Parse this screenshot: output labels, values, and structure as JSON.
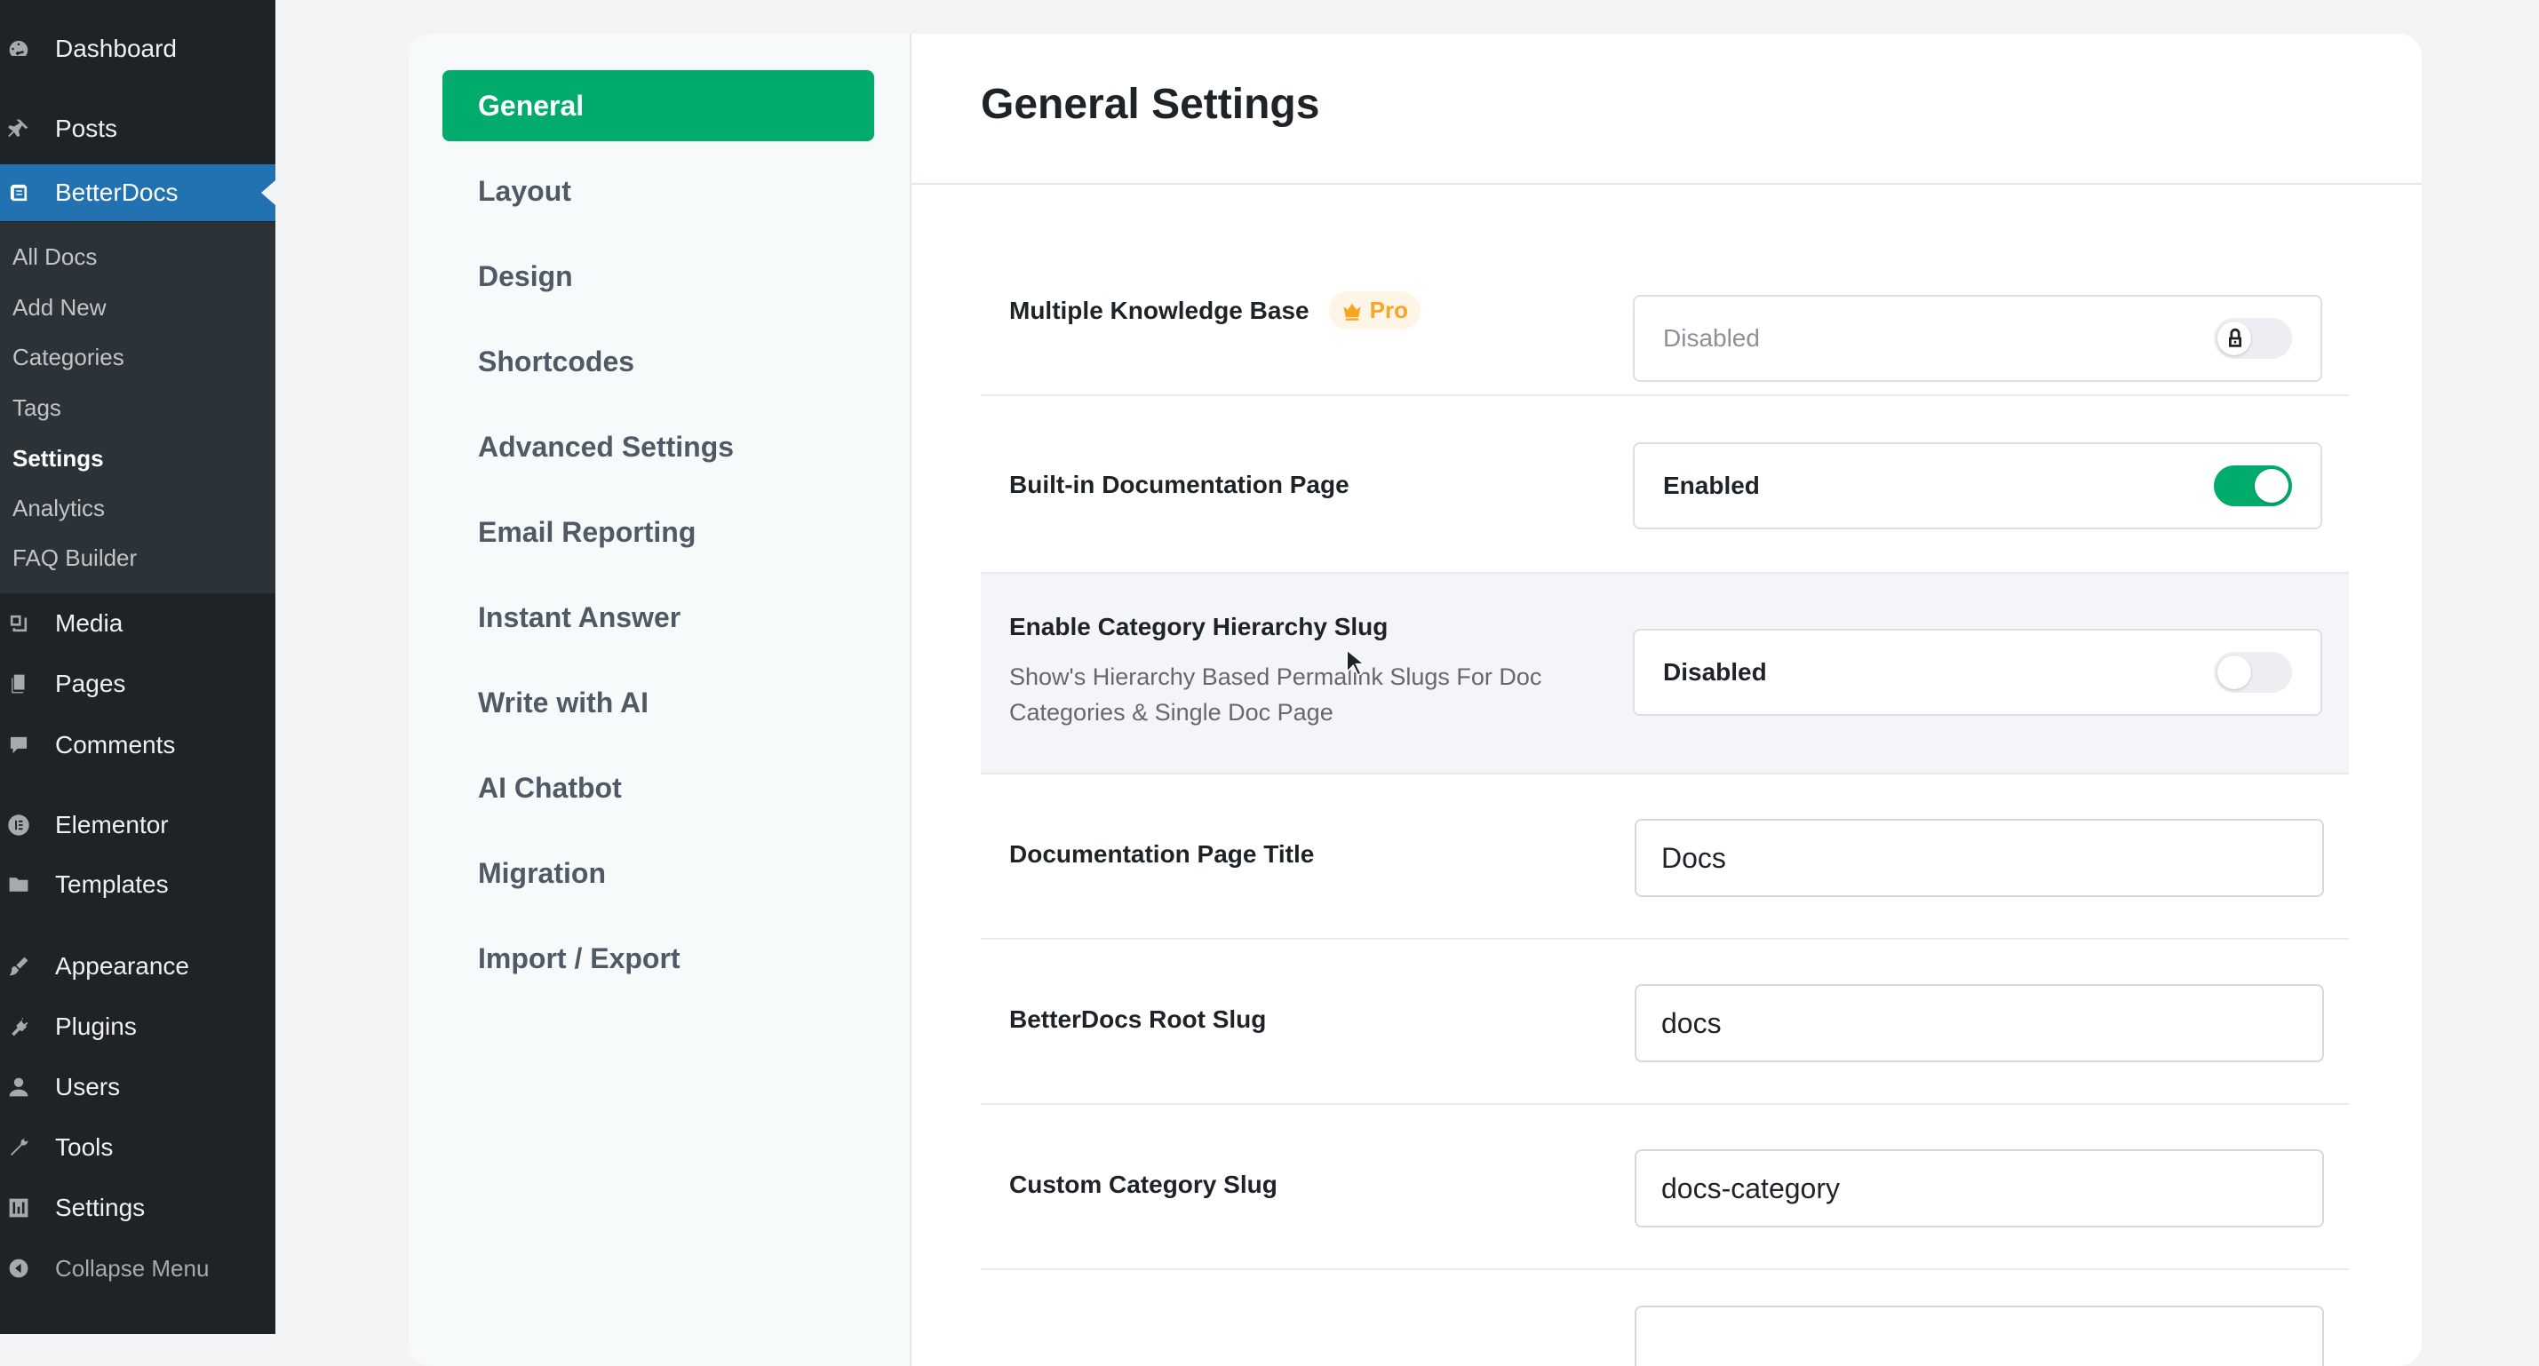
{
  "sidebar": {
    "items": [
      {
        "label": "Dashboard",
        "icon": "dashboard-icon"
      },
      {
        "label": "Posts",
        "icon": "pin-icon"
      },
      {
        "label": "BetterDocs",
        "icon": "betterdocs-icon"
      },
      {
        "label": "Media",
        "icon": "media-icon"
      },
      {
        "label": "Pages",
        "icon": "pages-icon"
      },
      {
        "label": "Comments",
        "icon": "comments-icon"
      },
      {
        "label": "Elementor",
        "icon": "elementor-icon"
      },
      {
        "label": "Templates",
        "icon": "folder-icon"
      },
      {
        "label": "Appearance",
        "icon": "brush-icon"
      },
      {
        "label": "Plugins",
        "icon": "plug-icon"
      },
      {
        "label": "Users",
        "icon": "user-icon"
      },
      {
        "label": "Tools",
        "icon": "wrench-icon"
      },
      {
        "label": "Settings",
        "icon": "settings-icon"
      }
    ],
    "submenu": [
      "All Docs",
      "Add New",
      "Categories",
      "Tags",
      "Settings",
      "Analytics",
      "FAQ Builder"
    ],
    "collapse_label": "Collapse Menu"
  },
  "nav": {
    "items": [
      "General",
      "Layout",
      "Design",
      "Shortcodes",
      "Advanced Settings",
      "Email Reporting",
      "Instant Answer",
      "Write with AI",
      "AI Chatbot",
      "Migration",
      "Import / Export"
    ],
    "active": "General"
  },
  "main": {
    "title": "General Settings",
    "settings": {
      "multiple_kb": {
        "label": "Multiple Knowledge Base",
        "badge": "Pro",
        "value": "Disabled"
      },
      "builtin_doc_page": {
        "label": "Built-in Documentation Page",
        "value": "Enabled"
      },
      "category_hierarchy": {
        "label": "Enable Category Hierarchy Slug",
        "description": "Show's Hierarchy Based Permalink Slugs For Doc Categories & Single Doc Page",
        "value": "Disabled"
      },
      "doc_page_title": {
        "label": "Documentation Page Title",
        "value": "Docs"
      },
      "root_slug": {
        "label": "BetterDocs Root Slug",
        "value": "docs"
      },
      "category_slug": {
        "label": "Custom Category Slug",
        "value": "docs-category"
      }
    }
  },
  "colors": {
    "accent": "#00ab6b",
    "wp_blue": "#2271b1",
    "sidebar_bg": "#1d2327",
    "pro": "#f5a623"
  }
}
